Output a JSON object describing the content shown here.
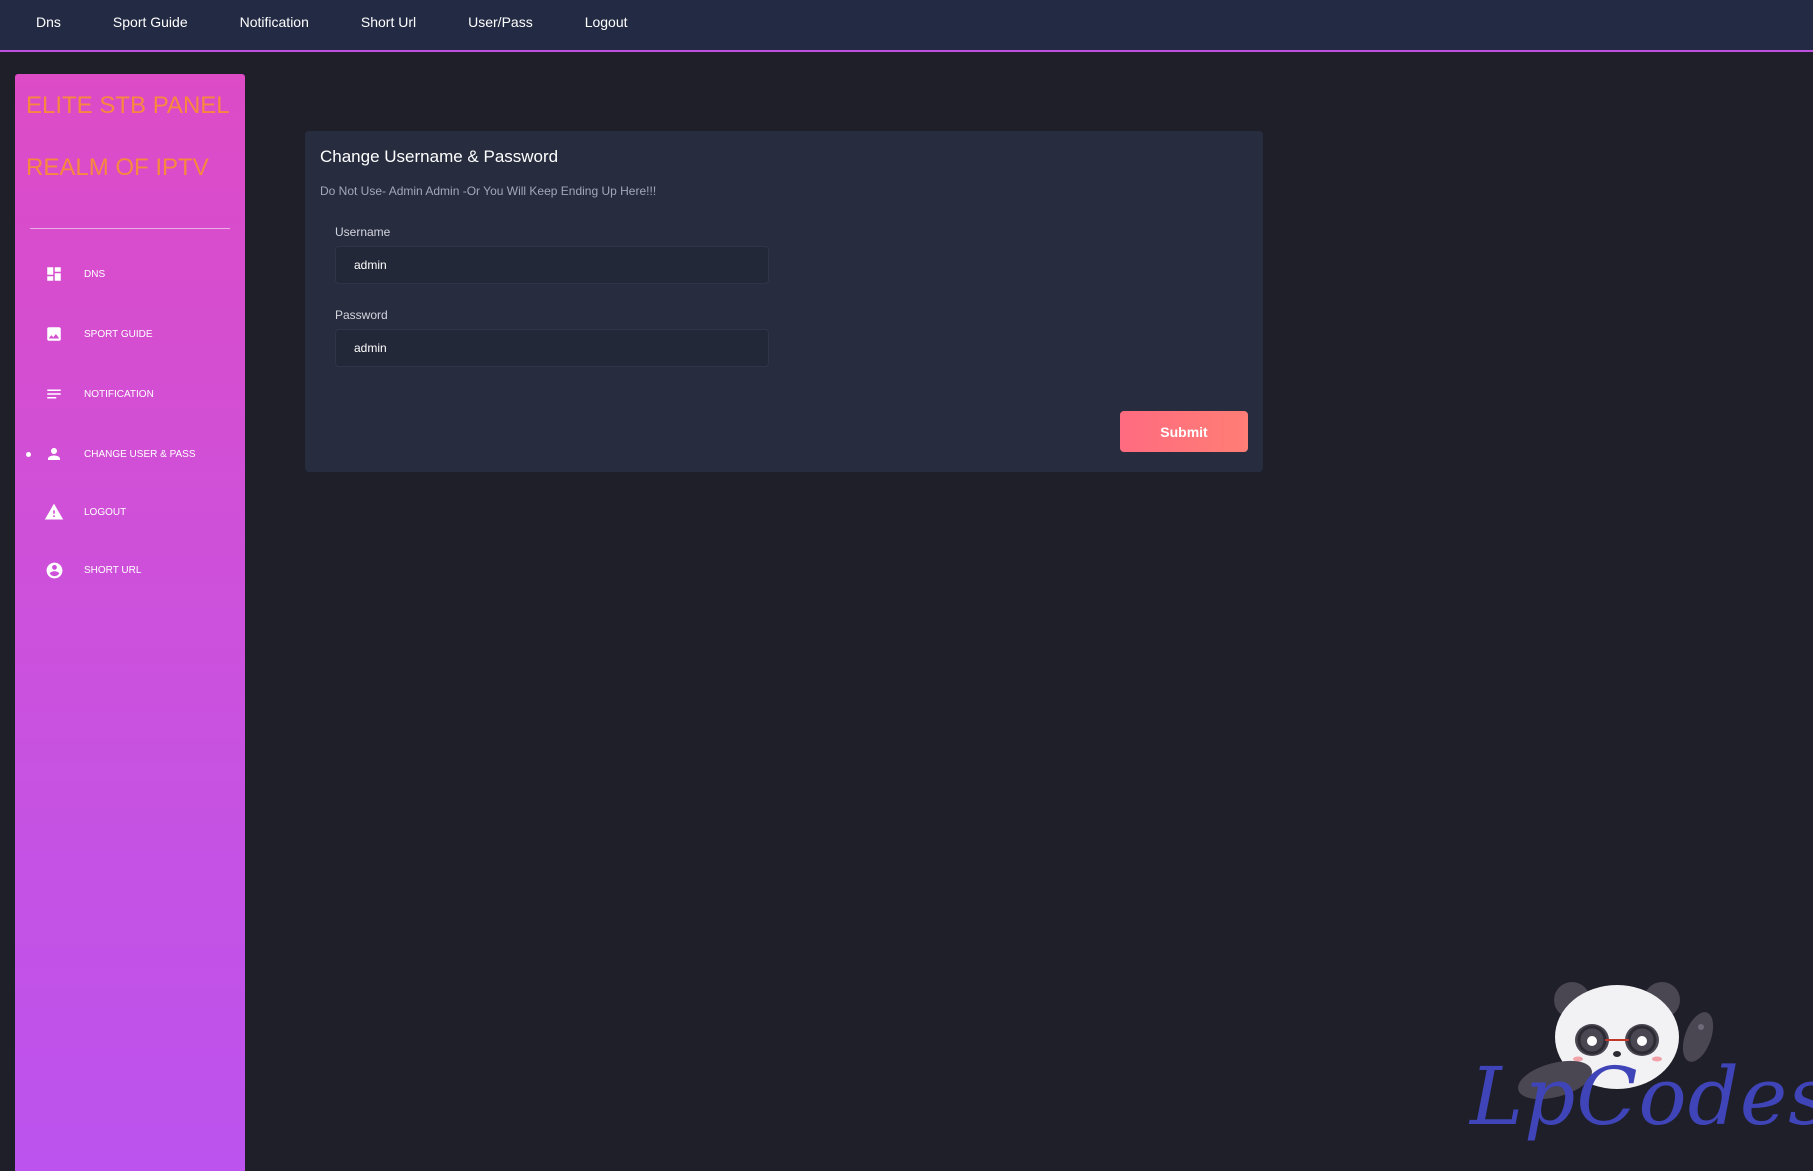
{
  "topnav": {
    "items": [
      "Dns",
      "Sport Guide",
      "Notification",
      "Short Url",
      "User/Pass",
      "Logout"
    ]
  },
  "sidebar": {
    "brand_line1": "ELITE STB PANEL",
    "brand_line2": "REALM OF IPTV",
    "items": [
      {
        "label": "DNS",
        "icon": "dashboard-icon"
      },
      {
        "label": "SPORT GUIDE",
        "icon": "image-icon"
      },
      {
        "label": "NOTIFICATION",
        "icon": "list-lines-icon"
      },
      {
        "label": "CHANGE USER & PASS",
        "icon": "person-icon",
        "active": true
      },
      {
        "label": "LOGOUT",
        "icon": "warning-icon"
      },
      {
        "label": "SHORT URL",
        "icon": "account-circle-icon"
      }
    ]
  },
  "card": {
    "title": "Change Username & Password",
    "subtitle": "Do Not Use- Admin Admin -Or You Will Keep Ending Up Here!!!",
    "username_label": "Username",
    "username_value": "admin",
    "password_label": "Password",
    "password_value": "admin",
    "submit_label": "Submit"
  },
  "watermark": {
    "text": "LpCodes"
  },
  "colors": {
    "topnav_bg": "#232a43",
    "accent_border": "#c04fe0",
    "sidebar_top": "#dd4bc6",
    "sidebar_bottom": "#bc53ee",
    "brand_text": "#f7893f",
    "card_bg": "#272c3f",
    "submit": "#ff6b80"
  }
}
